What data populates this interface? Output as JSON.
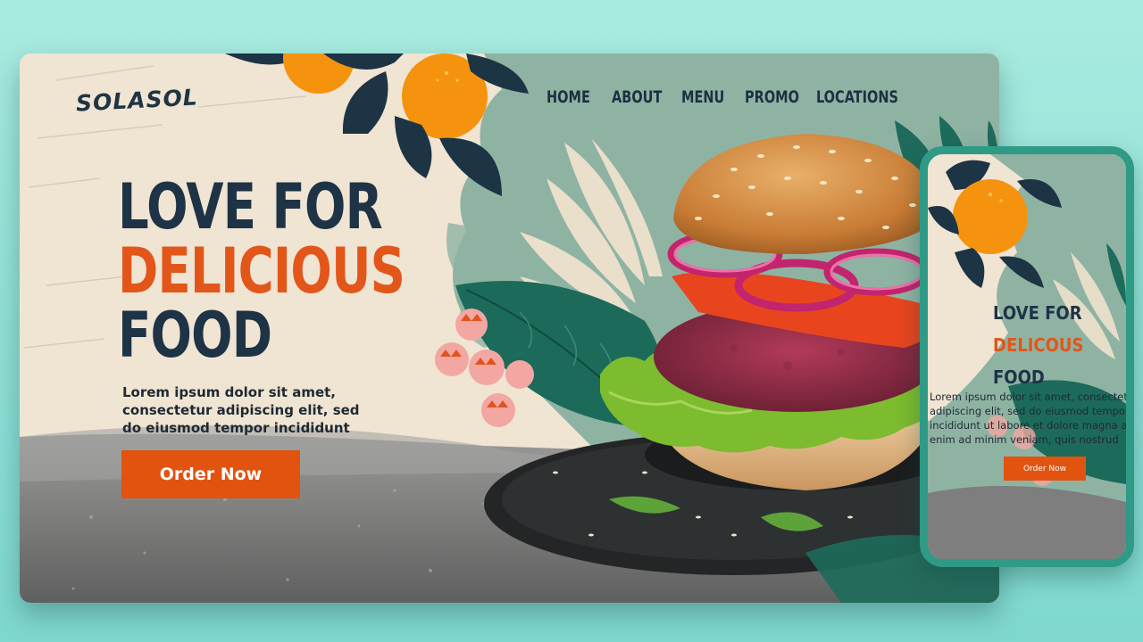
{
  "brand": {
    "logo_text": "SOLASOL"
  },
  "nav": {
    "items": [
      "HOME",
      "ABOUT",
      "MENU",
      "PROMO",
      "LOCATIONS"
    ]
  },
  "hero": {
    "line1": "LOVE FOR",
    "line2": "DELICIOUS",
    "line3": "FOOD",
    "description_lines": [
      "Lorem ipsum dolor sit amet,",
      "consectetur adipiscing elit, sed",
      "do eiusmod tempor incididunt"
    ],
    "cta_label": "Order Now"
  },
  "mobile": {
    "line1": "LOVE FOR",
    "line2": "DELICOUS",
    "line3": "FOOD",
    "description_lines": [
      "Lorem ipsum dolor sit amet, consectetur",
      "adipiscing elit, sed do eiusmod tempor",
      "incididunt ut labore et dolore magna aliqua. Ut",
      "enim ad minim veniam, quis nostrud"
    ],
    "cta_label": "Order Now"
  },
  "colors": {
    "accent": "#e2530f",
    "navy": "#1e3346",
    "sage": "#8fb3a3",
    "teal_frame": "#2f9a85",
    "cream": "#f0e4d3",
    "orange_fruit": "#f5930f"
  },
  "icons": [
    "orange-fruit-icon",
    "leaf-icon",
    "palm-leaf-icon",
    "burger-image"
  ]
}
